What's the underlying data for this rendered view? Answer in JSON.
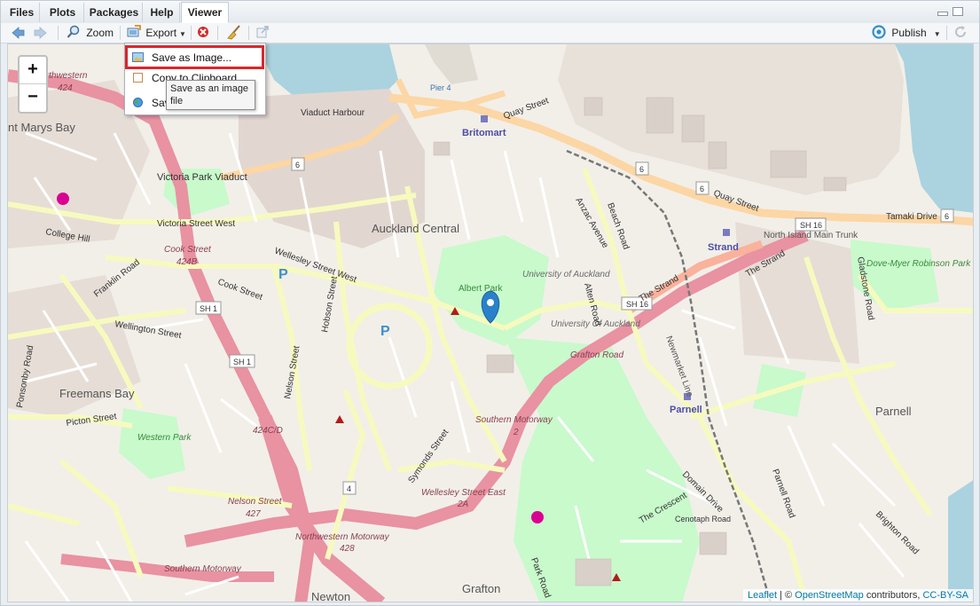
{
  "tabs": [
    {
      "label": "Files",
      "active": false
    },
    {
      "label": "Plots",
      "active": false
    },
    {
      "label": "Packages",
      "active": false
    },
    {
      "label": "Help",
      "active": false
    },
    {
      "label": "Viewer",
      "active": true
    }
  ],
  "toolbar": {
    "back_icon": "arrow-left-icon",
    "forward_icon": "arrow-right-icon",
    "zoom_label": "Zoom",
    "export_label": "Export",
    "remove_icon": "red-x-icon",
    "clear_icon": "broom-icon",
    "refresh_icon": "refresh-icon",
    "publish_label": "Publish"
  },
  "export_menu": {
    "items": [
      {
        "label": "Save as Image...",
        "icon": "image-icon"
      },
      {
        "label": "Copy to Clipboard",
        "icon": "clipboard-icon"
      },
      {
        "label": "Sav",
        "icon": "globe-icon"
      }
    ],
    "tooltip": "Save as an image file"
  },
  "map": {
    "zoom_in": "+",
    "zoom_out": "−",
    "attribution": {
      "leaflet": "Leaflet",
      "separator": " | © ",
      "osm": "OpenStreetMap",
      "contributors": " contributors, ",
      "license": "CC-BY-SA"
    },
    "labels": {
      "auckland_central": "Auckland Central",
      "freemans_bay": "Freemans Bay",
      "parnell": "Parnell",
      "parnell_station": "Parnell",
      "grafton": "Grafton",
      "newton": "Newton",
      "britomart": "Britomart",
      "strand": "Strand",
      "st_marys_bay": "nt Marys Bay",
      "quay_street": "Quay Street",
      "quay_street_2": "Quay Street",
      "tamaki_drive": "Tamaki Drive",
      "victoria_street_west": "Victoria Street West",
      "wellesley_street_west": "Wellesley Street West",
      "wellington_street": "Wellington Street",
      "franklin_road": "Franklin Road",
      "cook_street": "Cook Street",
      "nelson_street": "Nelson Street",
      "hobson_street": "Hobson Street",
      "grafton_road": "Grafton Road",
      "southern_motorway": "Southern Motorway",
      "northwestern_motorway": "Northwestern Motorway",
      "albert_park": "Albert Park",
      "university": "University of Auckland",
      "university_2": "University Of Auckland",
      "victoria_park_viaduct": "Victoria Park Viaduct",
      "western_park": "Western Park",
      "the_strand": "The Strand",
      "newmarket_line": "Newmarket Line",
      "sh1": "SH 1",
      "sh1b": "SH 1",
      "sh16": "SH 16",
      "sh16b": "SH 16",
      "route6a": "6",
      "route6b": "6",
      "route6c": "6",
      "route6d": "6",
      "route4": "4",
      "viaduct_harbour": "Viaduct Harbour",
      "pier4": "Pier 4",
      "college_hill": "College Hill",
      "picton_street": "Picton Street",
      "ponsonby_road": "Ponsonby Road",
      "anzac_avenue": "Anzac Avenue",
      "beach_road": "Beach Road",
      "symonds_street": "Symonds Street",
      "wellesley_street_east": "Wellesley Street East",
      "nelson_street_427": "Nelson Street",
      "southern_motorway_2": "Southern Motorway",
      "dove_myer": "Dove-Myer Robinson Park",
      "north_island_main_trunk": "North Island Main Trunk",
      "alten_road": "Alten Road",
      "park_road": "Park Road",
      "gladstone_road": "Gladstone Road",
      "parnell_road": "Parnell Road",
      "the_crescent": "The Crescent",
      "domain_drive": "Domain Drive",
      "cenotaph_road": "Cenotaph Road",
      "brighton_road": "Brighton Road",
      "cook_street_424b": "Cook Street",
      "n424b": "424B",
      "n424": "424",
      "n424cd": "424C/D",
      "n427": "427",
      "n428": "428",
      "n2a": "2A",
      "n2": "2",
      "northwestern_top": "Northwestern"
    }
  },
  "colors": {
    "motorway": "#e892a2",
    "trunk": "#f9b29c",
    "primary": "#fcd6a4",
    "secondary": "#f7fabf",
    "water": "#aad3df",
    "park": "#c8facc",
    "highlight": "#d9262c",
    "marker": "#2a81cb"
  }
}
